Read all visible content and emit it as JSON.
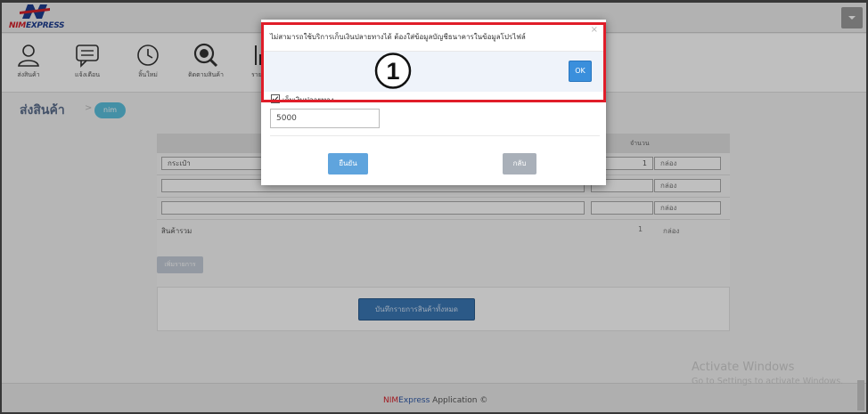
{
  "app": {
    "logo_text_1": "NIM",
    "logo_text_2": "EXPRESS",
    "menu_icon": "caret-down-icon"
  },
  "nav": {
    "items": [
      {
        "label": "ส่งสินค้า",
        "icon": "user-icon"
      },
      {
        "label": "แจ้งเตือน",
        "icon": "chat-icon"
      },
      {
        "label": "ลิ้นใหม่",
        "icon": "clock-icon"
      },
      {
        "label": "ติดตามสินค้า",
        "icon": "search-icon"
      },
      {
        "label": "รายงาน",
        "icon": "chart-icon"
      }
    ]
  },
  "page": {
    "title": "ส่งสินค้า",
    "crumb_separator": ">",
    "crumb_tag": "nim"
  },
  "table": {
    "qty_header": "จำนวน",
    "rows": [
      {
        "name": "กระเป๋า",
        "qty": "1",
        "unit": "กล่อง"
      },
      {
        "name": "",
        "qty": "",
        "unit": "กล่อง"
      },
      {
        "name": "",
        "qty": "",
        "unit": "กล่อง"
      }
    ],
    "summary": {
      "label": "สินค้ารวม",
      "qty": "1",
      "unit": "กล่อง"
    }
  },
  "buttons": {
    "add_item": "เพิ่มรายการ",
    "save_all": "บันทึกรายการสินค้าทั้งหมด"
  },
  "modal": {
    "message": "ไม่สามารถใช้บริการเก็บเงินปลายทางได้ ต้องใส่ข้อมูลบัญชีธนาคารในข้อมูลโปรไฟล์",
    "close": "×",
    "ok": "OK",
    "step_number": "1",
    "cod_label": "เก็บเงินปลายทาง",
    "cod_checked": true,
    "amount_value": "5000",
    "confirm": "ยืนยัน",
    "back": "กลับ"
  },
  "footer": {
    "brand_nim": "NIM",
    "brand_express": "Express",
    "rest": " Application ©"
  },
  "watermark": {
    "line1": "Activate Windows",
    "line2": "Go to Settings to activate Windows."
  },
  "colors": {
    "highlight_border": "#e01d29",
    "ok_button": "#3a8fdc",
    "save_button": "#3a77b4",
    "crumb_pill": "#5bc0de",
    "brand_red": "#d4202a"
  }
}
